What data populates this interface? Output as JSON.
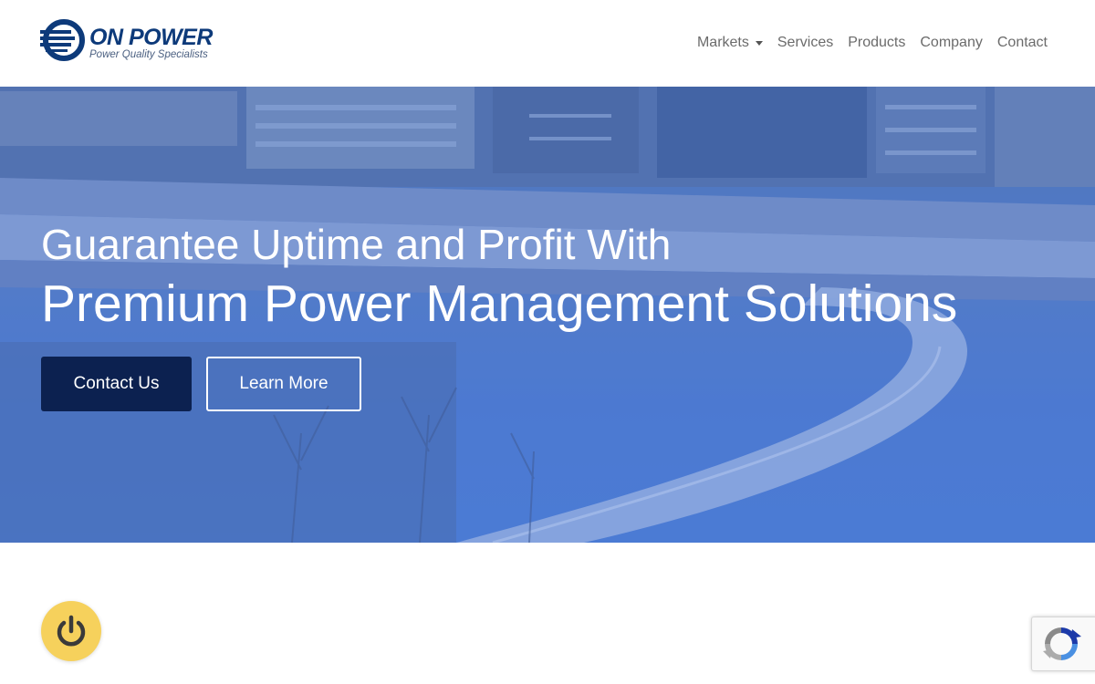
{
  "brand": {
    "name": "ON POWER",
    "tagline": "Power Quality Specialists",
    "color": "#0d3a7a"
  },
  "nav": {
    "items": [
      {
        "label": "Markets",
        "has_dropdown": true
      },
      {
        "label": "Services"
      },
      {
        "label": "Products"
      },
      {
        "label": "Company"
      },
      {
        "label": "Contact"
      }
    ]
  },
  "hero": {
    "line1": "Guarantee Uptime and Profit With",
    "line2": "Premium Power Management Solutions",
    "primary_button": "Contact Us",
    "secondary_button": "Learn More",
    "primary_color": "#0c2150"
  },
  "floating": {
    "power_button_icon": "power-icon",
    "power_button_color": "#f6d15c",
    "recaptcha_icon": "recaptcha-icon"
  }
}
